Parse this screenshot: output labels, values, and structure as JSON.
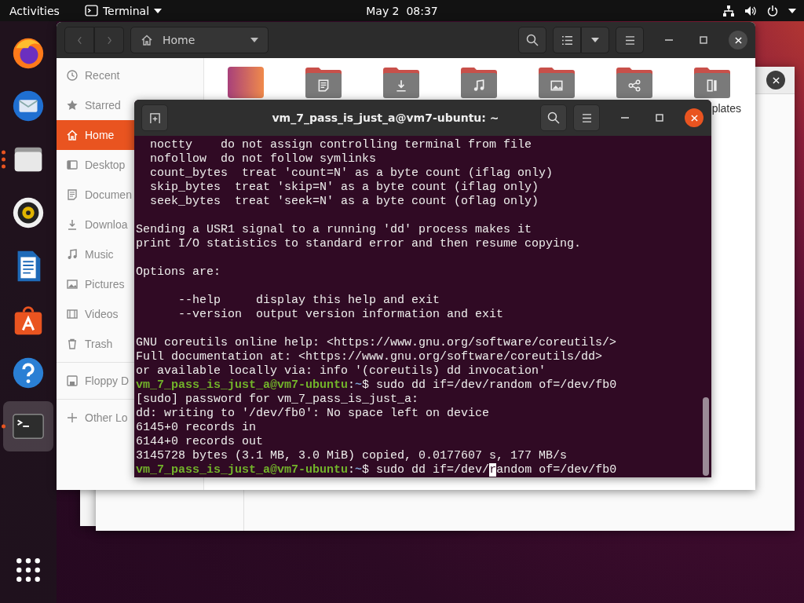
{
  "top_bar": {
    "activities": "Activities",
    "app_menu": "Terminal",
    "clock": "May 2  08:37"
  },
  "dock": [
    {
      "running": false,
      "selected": false
    },
    {
      "running": false,
      "selected": false
    },
    {
      "running": true,
      "multiple_windows": true,
      "selected": false
    },
    {
      "running": false,
      "selected": false
    },
    {
      "running": false,
      "selected": false
    },
    {
      "running": false,
      "selected": false
    },
    {
      "running": false,
      "selected": false
    },
    {
      "running": true,
      "multiple_windows": false,
      "selected": true
    }
  ],
  "files_window": {
    "path": "Home",
    "sidebar": [
      {
        "label": "Recent",
        "selected": false
      },
      {
        "label": "Starred",
        "selected": false
      },
      {
        "label": "Home",
        "selected": true
      },
      {
        "label": "Desktop",
        "selected": false
      },
      {
        "label": "Documen",
        "selected": false
      },
      {
        "label": "Downloa",
        "selected": false
      },
      {
        "label": "Music",
        "selected": false
      },
      {
        "label": "Pictures",
        "selected": false
      },
      {
        "label": "Videos",
        "selected": false
      },
      {
        "label": "Trash",
        "selected": false
      }
    ],
    "devices": [
      {
        "label": "Floppy D",
        "selected": false
      }
    ],
    "other": [
      {
        "label": "Other Lo",
        "selected": false
      }
    ],
    "folders": [
      {
        "kind": "desktop"
      },
      {
        "kind": "folder"
      },
      {
        "kind": "folder"
      },
      {
        "kind": "folder"
      },
      {
        "kind": "folder"
      },
      {
        "kind": "folder"
      },
      {
        "kind": "folder",
        "label": "plates"
      }
    ]
  },
  "terminal": {
    "title": "vm_7_pass_is_just_a@vm7-ubuntu: ~",
    "lines": [
      {
        "kind": "output",
        "text": "  noctty    do not assign controlling terminal from file"
      },
      {
        "kind": "output",
        "text": "  nofollow  do not follow symlinks"
      },
      {
        "kind": "output",
        "text": "  count_bytes  treat 'count=N' as a byte count (iflag only)"
      },
      {
        "kind": "output",
        "text": "  skip_bytes  treat 'skip=N' as a byte count (iflag only)"
      },
      {
        "kind": "output",
        "text": "  seek_bytes  treat 'seek=N' as a byte count (oflag only)"
      },
      {
        "kind": "blank"
      },
      {
        "kind": "output",
        "text": "Sending a USR1 signal to a running 'dd' process makes it"
      },
      {
        "kind": "output",
        "text": "print I/O statistics to standard error and then resume copying."
      },
      {
        "kind": "blank"
      },
      {
        "kind": "output",
        "text": "Options are:"
      },
      {
        "kind": "blank"
      },
      {
        "kind": "output",
        "text": "      --help     display this help and exit"
      },
      {
        "kind": "output",
        "text": "      --version  output version information and exit"
      },
      {
        "kind": "blank"
      },
      {
        "kind": "output",
        "text": "GNU coreutils online help: <https://www.gnu.org/software/coreutils/>"
      },
      {
        "kind": "output",
        "text": "Full documentation at: <https://www.gnu.org/software/coreutils/dd>"
      },
      {
        "kind": "output",
        "text": "or available locally via: info '(coreutils) dd invocation'"
      },
      {
        "kind": "prompt",
        "user": "vm_7_pass_is_just_a@vm7-ubuntu",
        "separator": ":",
        "path": "~",
        "symbol": "$",
        "command": " sudo dd if=/dev/random of=/dev/fb0"
      },
      {
        "kind": "output",
        "text": "[sudo] password for vm_7_pass_is_just_a:"
      },
      {
        "kind": "output",
        "text": "dd: writing to '/dev/fb0': No space left on device"
      },
      {
        "kind": "output",
        "text": "6145+0 records in"
      },
      {
        "kind": "output",
        "text": "6144+0 records out"
      },
      {
        "kind": "output",
        "text": "3145728 bytes (3.1 MB, 3.0 MiB) copied, 0.0177607 s, 177 MB/s"
      },
      {
        "kind": "prompt",
        "user": "vm_7_pass_is_just_a@vm7-ubuntu",
        "separator": ":",
        "path": "~",
        "symbol": "$",
        "command": " sudo dd if=/dev/",
        "cursor": "r",
        "after": "andom of=/dev/fb0"
      }
    ]
  }
}
